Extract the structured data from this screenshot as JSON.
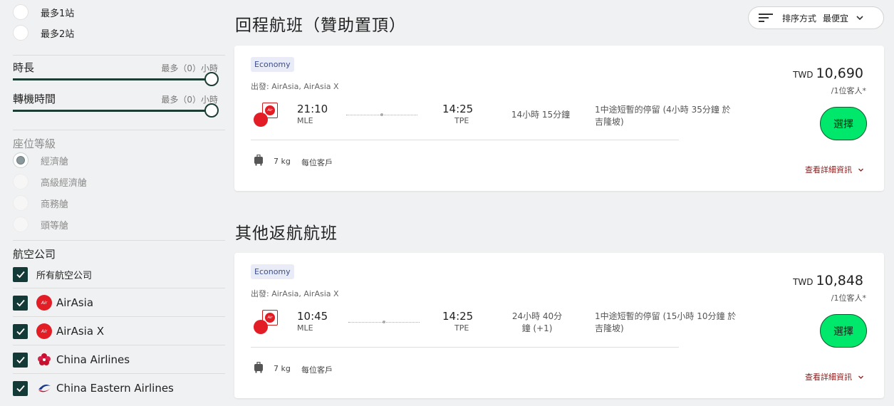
{
  "sidebar": {
    "stops": [
      {
        "label": "最多1站"
      },
      {
        "label": "最多2站"
      }
    ],
    "duration": {
      "title": "時長",
      "hint": "最多（0）小時",
      "level": 1.0
    },
    "layover": {
      "title": "轉機時間",
      "hint": "最多（0）小時",
      "level": 1.0
    },
    "cabin": {
      "title": "座位等級",
      "options": [
        {
          "label": "經濟艙",
          "selected": true
        },
        {
          "label": "高級經濟艙",
          "selected": false
        },
        {
          "label": "商務艙",
          "selected": false
        },
        {
          "label": "頭等艙",
          "selected": false
        }
      ]
    },
    "airlines": {
      "title": "航空公司",
      "all_label": "所有航空公司",
      "items": [
        {
          "label": "AirAsia",
          "icon": "airasia-logo-icon"
        },
        {
          "label": "AirAsia X",
          "icon": "airasia-logo-icon"
        },
        {
          "label": "China Airlines",
          "icon": "china-airlines-logo-icon"
        },
        {
          "label": "China Eastern Airlines",
          "icon": "china-eastern-logo-icon"
        }
      ]
    }
  },
  "sort": {
    "label": "排序方式",
    "value": "最便宜"
  },
  "sections": {
    "sponsored_title": "回程航班（贊助置頂）",
    "other_title": "其他返航航班"
  },
  "flights": [
    {
      "cabin": "Economy",
      "depart_label": "出發: AirAsia, AirAsia X",
      "dep_time": "21:10",
      "dep_code": "MLE",
      "arr_time": "14:25",
      "arr_code": "TPE",
      "duration_line1": "14小時 15分鐘",
      "duration_line2": "",
      "stops_line1": "1中途短暫的停留 (4小時 35分鐘 於",
      "stops_line2": "吉隆坡)",
      "baggage_weight": "7 kg",
      "baggage_note": "每位客戶",
      "currency": "TWD",
      "price": "10,690",
      "per_pax": "/1位客人*",
      "select_label": "選擇",
      "details_label": "查看詳細資訊"
    },
    {
      "cabin": "Economy",
      "depart_label": "出發: AirAsia, AirAsia X",
      "dep_time": "10:45",
      "dep_code": "MLE",
      "arr_time": "14:25",
      "arr_code": "TPE",
      "duration_line1": "24小時 40分",
      "duration_line2": "鐘 (+1)",
      "stops_line1": "1中途短暫的停留 (15小時 10分鐘 於",
      "stops_line2": "吉隆坡)",
      "baggage_weight": "7 kg",
      "baggage_note": "每位客戶",
      "currency": "TWD",
      "price": "10,848",
      "per_pax": "/1位客人*",
      "select_label": "選擇",
      "details_label": "查看詳細資訊"
    }
  ],
  "colors": {
    "accent_dark": "#133a36",
    "select_button": "#00e86b",
    "details_link": "#8a1c1c",
    "badge_bg": "#e9ecf7"
  }
}
